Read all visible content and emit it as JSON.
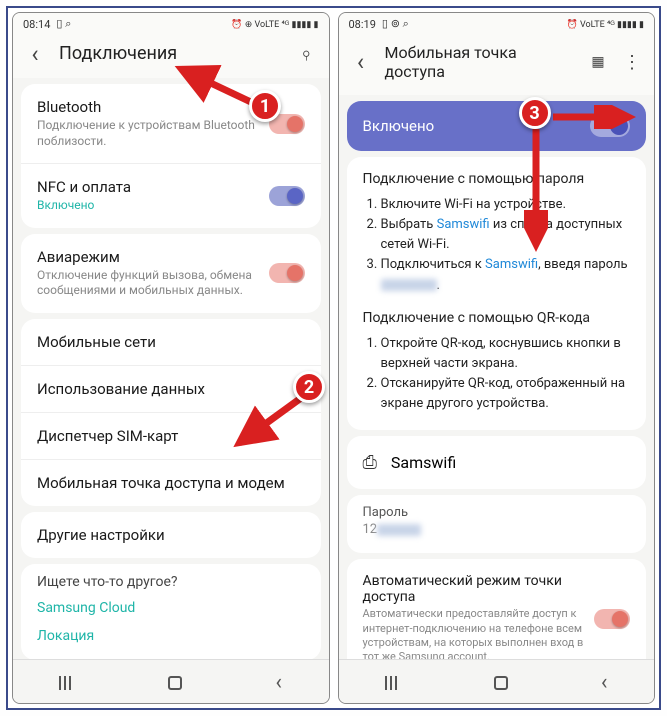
{
  "annotations": {
    "b1": "1",
    "b2": "2",
    "b3": "3"
  },
  "left": {
    "time": "08:14",
    "status_icons": "⏰ ⊕ VoLTE ⁴ᴳ ▮▮▮▮ ▮",
    "header": "Подключения",
    "bluetooth": {
      "title": "Bluetooth",
      "sub": "Подключение к устройствам Bluetooth поблизости."
    },
    "nfc": {
      "title": "NFC и оплата",
      "sub": "Включено"
    },
    "air": {
      "title": "Авиарежим",
      "sub": "Отключение функций вызова, обмена сообщениями и мобильных данных."
    },
    "mobile_net": "Мобильные сети",
    "data_usage": "Использование данных",
    "sim_mgr": "Диспетчер SIM-карт",
    "hotspot": "Мобильная точка доступа и модем",
    "other": "Другие настройки",
    "searching": "Ищете что-то другое?",
    "samsung_cloud": "Samsung Cloud",
    "location": "Локация"
  },
  "right": {
    "time": "08:19",
    "status_icons": "⏰ VoLTE ⁴ᴳ ▮▮▮▮ ▮",
    "header": "Мобильная точка доступа",
    "enabled": "Включено",
    "pwd_title": "Подключение с помощью пароля",
    "s1_a": "Включите Wi-Fi на устройстве.",
    "s2_a": "Выбрать ",
    "s2_link": "Samswifi",
    "s2_b": " из списка доступных сетей Wi-Fi.",
    "s3_a": "Подключиться к ",
    "s3_link": "Samswifi",
    "s3_b": ", введя пароль ",
    "qr_title": "Подключение с помощью QR-кода",
    "q1": "Откройте QR-код, коснувшись кнопки в верхней части экрана.",
    "q2": "Отсканируйте QR-код, отображенный на экране другого устройства.",
    "network": "Samswifi",
    "pwd_label": "Пароль",
    "pwd_value": "12",
    "auto": {
      "title": "Автоматический режим точки доступа",
      "sub": "Автоматически предоставляйте доступ к интернет-подключению на телефоне всем устройствам, на которых выполнен вход в тот же Samsung account."
    }
  }
}
